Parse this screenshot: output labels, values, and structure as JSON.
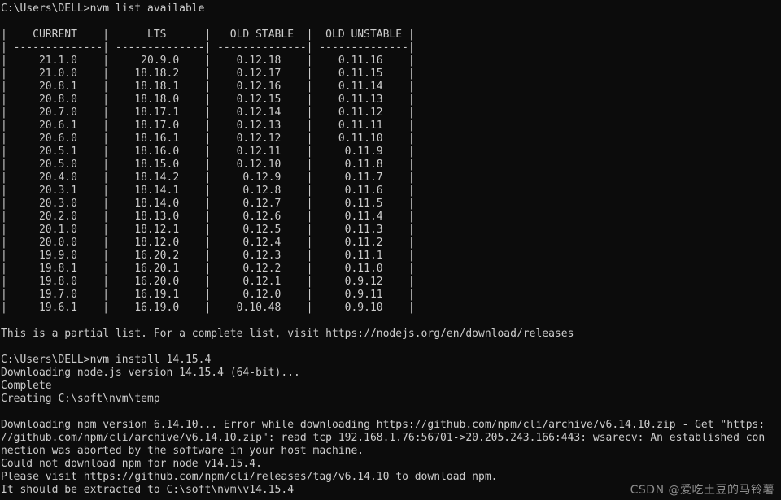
{
  "terminal": {
    "background_color": "#0c0c0c",
    "foreground_color": "#cccccc",
    "prompt_line_1": "C:\\Users\\DELL>nvm list available",
    "prompt_line_2": "C:\\Users\\DELL>nvm install 14.15.4"
  },
  "table": {
    "border_left": "|",
    "border_right": "|",
    "separator": "|",
    "underline": "--------------",
    "headers": [
      "CURRENT",
      "LTS",
      "OLD STABLE",
      "OLD UNSTABLE"
    ],
    "columns": {
      "current": [
        "21.1.0",
        "21.0.0",
        "20.8.1",
        "20.8.0",
        "20.7.0",
        "20.6.1",
        "20.6.0",
        "20.5.1",
        "20.5.0",
        "20.4.0",
        "20.3.1",
        "20.3.0",
        "20.2.0",
        "20.1.0",
        "20.0.0",
        "19.9.0",
        "19.8.1",
        "19.8.0",
        "19.7.0",
        "19.6.1"
      ],
      "lts": [
        "20.9.0",
        "18.18.2",
        "18.18.1",
        "18.18.0",
        "18.17.1",
        "18.17.0",
        "18.16.1",
        "18.16.0",
        "18.15.0",
        "18.14.2",
        "18.14.1",
        "18.14.0",
        "18.13.0",
        "18.12.1",
        "18.12.0",
        "16.20.2",
        "16.20.1",
        "16.20.0",
        "16.19.1",
        "16.19.0"
      ],
      "old_stable": [
        "0.12.18",
        "0.12.17",
        "0.12.16",
        "0.12.15",
        "0.12.14",
        "0.12.13",
        "0.12.12",
        "0.12.11",
        "0.12.10",
        "0.12.9",
        "0.12.8",
        "0.12.7",
        "0.12.6",
        "0.12.5",
        "0.12.4",
        "0.12.3",
        "0.12.2",
        "0.12.1",
        "0.12.0",
        "0.10.48"
      ],
      "old_unstable": [
        "0.11.16",
        "0.11.15",
        "0.11.14",
        "0.11.13",
        "0.11.12",
        "0.11.11",
        "0.11.10",
        "0.11.9",
        "0.11.8",
        "0.11.7",
        "0.11.6",
        "0.11.5",
        "0.11.4",
        "0.11.3",
        "0.11.2",
        "0.11.1",
        "0.11.0",
        "0.9.12",
        "0.9.11",
        "0.9.10"
      ]
    }
  },
  "output": {
    "partial_list_note": "This is a partial list. For a complete list, visit https://nodejs.org/en/download/releases",
    "downloading_node": "Downloading node.js version 14.15.4 (64-bit)...",
    "complete": "Complete",
    "creating_temp": "Creating C:\\soft\\nvm\\temp",
    "npm_error_line_1": "Downloading npm version 6.14.10... Error while downloading https://github.com/npm/cli/archive/v6.14.10.zip - Get \"https:",
    "npm_error_line_2": "//github.com/npm/cli/archive/v6.14.10.zip\": read tcp 192.168.1.76:56701->20.205.243.166:443: wsarecv: An established con",
    "npm_error_line_3": "nection was aborted by the software in your host machine.",
    "could_not_download": "Could not download npm for node v14.15.4.",
    "please_visit": "Please visit https://github.com/npm/cli/releases/tag/v6.14.10 to download npm.",
    "should_extract": "It should be extracted to C:\\soft\\nvm\\v14.15.4"
  },
  "watermark": {
    "text": "CSDN @爱吃土豆的马铃薯",
    "color": "#9a9a9a"
  }
}
